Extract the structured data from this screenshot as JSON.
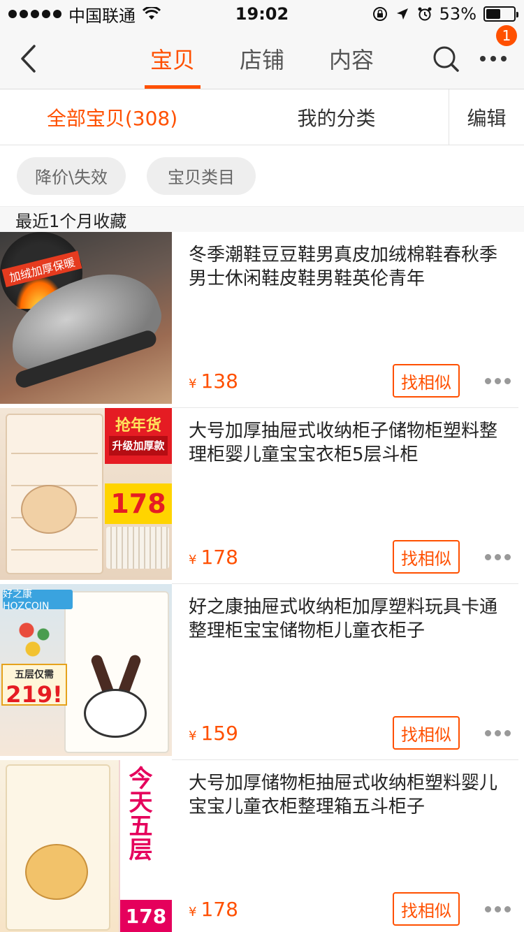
{
  "status_bar": {
    "carrier": "中国联通",
    "time": "19:02",
    "battery": "53%",
    "battery_level": 0.53
  },
  "nav": {
    "tabs": [
      {
        "label": "宝贝",
        "active": true
      },
      {
        "label": "店铺",
        "active": false
      },
      {
        "label": "内容",
        "active": false
      }
    ],
    "badge_count": "1",
    "icons": [
      "back-chevron-icon",
      "search-icon",
      "more-dots-icon"
    ]
  },
  "sub_tabs": {
    "all_items": "全部宝贝(308)",
    "my_categories": "我的分类",
    "edit": "编辑"
  },
  "filters": [
    "降价\\失效",
    "宝贝类目"
  ],
  "section_title": "最近1个月收藏",
  "colors": {
    "accent": "#ff5000"
  },
  "products": [
    {
      "title": "冬季潮鞋豆豆鞋男真皮加绒棉鞋春秋季男士休闲鞋皮鞋男鞋英伦青年",
      "currency": "¥",
      "price": "138",
      "similar_label": "找相似",
      "thumb_text": [
        "加绒加厚保暖"
      ]
    },
    {
      "title": "大号加厚抽屉式收纳柜子储物柜塑料整理柜婴儿童宝宝衣柜5层斗柜",
      "currency": "¥",
      "price": "178",
      "similar_label": "找相似",
      "thumb_text": [
        "抢年货",
        "升级加厚款",
        "178"
      ]
    },
    {
      "title": "好之康抽屉式收纳柜加厚塑料玩具卡通整理柜宝宝储物柜儿童衣柜子",
      "currency": "¥",
      "price": "159",
      "similar_label": "找相似",
      "thumb_text": [
        "好之康 HOZCOIN",
        "五层仅需",
        "219!"
      ]
    },
    {
      "title": "大号加厚储物柜抽屉式收纳柜塑料婴儿宝宝儿童衣柜整理箱五斗柜子",
      "currency": "¥",
      "price": "178",
      "similar_label": "找相似",
      "thumb_text": [
        "今天五层",
        "178"
      ]
    }
  ]
}
